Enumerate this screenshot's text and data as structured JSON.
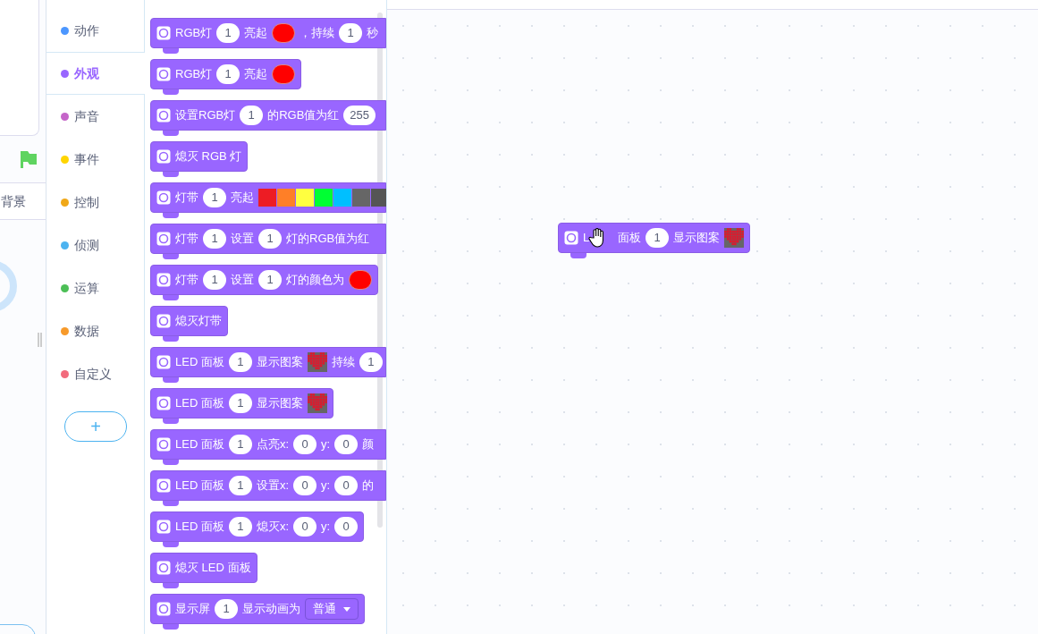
{
  "stage_tabs": [
    {
      "label": "背景",
      "selected": false
    }
  ],
  "categories": [
    {
      "label": "动作",
      "color": "#4c97ff",
      "selected": false
    },
    {
      "label": "外观",
      "color": "#9966ff",
      "selected": true
    },
    {
      "label": "声音",
      "color": "#c565c9",
      "selected": false
    },
    {
      "label": "事件",
      "color": "#ffd500",
      "selected": false
    },
    {
      "label": "控制",
      "color": "#f0a818",
      "selected": false
    },
    {
      "label": "侦测",
      "color": "#4cb3f0",
      "selected": false
    },
    {
      "label": "运算",
      "color": "#4cbf56",
      "selected": false
    },
    {
      "label": "数据",
      "color": "#f79a2a",
      "selected": false
    },
    {
      "label": "自定义",
      "color": "#f26b7c",
      "selected": false
    }
  ],
  "add_extension": {
    "label": "+"
  },
  "palette_blocks": [
    {
      "cut": true,
      "parts": [
        {
          "kind": "text",
          "text": "RGB灯"
        },
        {
          "kind": "number",
          "text": "1"
        },
        {
          "kind": "text",
          "text": "亮起"
        },
        {
          "kind": "color",
          "color": "#ff0000"
        },
        {
          "kind": "text",
          "text": "，持续"
        },
        {
          "kind": "number",
          "text": "1"
        },
        {
          "kind": "text",
          "text": "秒"
        }
      ]
    },
    {
      "cut": false,
      "parts": [
        {
          "kind": "text",
          "text": "RGB灯"
        },
        {
          "kind": "number",
          "text": "1"
        },
        {
          "kind": "text",
          "text": "亮起"
        },
        {
          "kind": "color",
          "color": "#ff0000"
        }
      ]
    },
    {
      "cut": true,
      "parts": [
        {
          "kind": "text",
          "text": "设置RGB灯"
        },
        {
          "kind": "number",
          "text": "1"
        },
        {
          "kind": "text",
          "text": "的RGB值为红"
        },
        {
          "kind": "number",
          "text": "255"
        }
      ]
    },
    {
      "cut": false,
      "parts": [
        {
          "kind": "text",
          "text": "熄灭 RGB 灯"
        }
      ]
    },
    {
      "cut": true,
      "parts": [
        {
          "kind": "text",
          "text": "灯带"
        },
        {
          "kind": "number",
          "text": "1"
        },
        {
          "kind": "text",
          "text": "亮起"
        },
        {
          "kind": "strip"
        }
      ]
    },
    {
      "cut": true,
      "parts": [
        {
          "kind": "text",
          "text": "灯带"
        },
        {
          "kind": "number",
          "text": "1"
        },
        {
          "kind": "text",
          "text": "设置"
        },
        {
          "kind": "number",
          "text": "1"
        },
        {
          "kind": "text",
          "text": "灯的RGB值为红"
        }
      ]
    },
    {
      "cut": false,
      "parts": [
        {
          "kind": "text",
          "text": "灯带"
        },
        {
          "kind": "number",
          "text": "1"
        },
        {
          "kind": "text",
          "text": "设置"
        },
        {
          "kind": "number",
          "text": "1"
        },
        {
          "kind": "text",
          "text": "灯的颜色为"
        },
        {
          "kind": "color",
          "color": "#ff0000"
        }
      ]
    },
    {
      "cut": false,
      "parts": [
        {
          "kind": "text",
          "text": "熄灭灯带"
        }
      ]
    },
    {
      "cut": true,
      "parts": [
        {
          "kind": "text",
          "text": "LED 面板"
        },
        {
          "kind": "number",
          "text": "1"
        },
        {
          "kind": "text",
          "text": "显示图案"
        },
        {
          "kind": "pattern"
        },
        {
          "kind": "text",
          "text": "持续"
        },
        {
          "kind": "number",
          "text": "1"
        }
      ]
    },
    {
      "cut": false,
      "parts": [
        {
          "kind": "text",
          "text": "LED 面板"
        },
        {
          "kind": "number",
          "text": "1"
        },
        {
          "kind": "text",
          "text": "显示图案"
        },
        {
          "kind": "pattern"
        }
      ]
    },
    {
      "cut": true,
      "parts": [
        {
          "kind": "text",
          "text": "LED 面板"
        },
        {
          "kind": "number",
          "text": "1"
        },
        {
          "kind": "text",
          "text": "点亮x:"
        },
        {
          "kind": "number",
          "text": "0"
        },
        {
          "kind": "text",
          "text": "y:"
        },
        {
          "kind": "number",
          "text": "0"
        },
        {
          "kind": "text",
          "text": "颜"
        }
      ]
    },
    {
      "cut": true,
      "parts": [
        {
          "kind": "text",
          "text": "LED 面板"
        },
        {
          "kind": "number",
          "text": "1"
        },
        {
          "kind": "text",
          "text": "设置x:"
        },
        {
          "kind": "number",
          "text": "0"
        },
        {
          "kind": "text",
          "text": "y:"
        },
        {
          "kind": "number",
          "text": "0"
        },
        {
          "kind": "text",
          "text": "的"
        }
      ]
    },
    {
      "cut": false,
      "parts": [
        {
          "kind": "text",
          "text": "LED 面板"
        },
        {
          "kind": "number",
          "text": "1"
        },
        {
          "kind": "text",
          "text": "熄灭x:"
        },
        {
          "kind": "number",
          "text": "0"
        },
        {
          "kind": "text",
          "text": "y:"
        },
        {
          "kind": "number",
          "text": "0"
        }
      ]
    },
    {
      "cut": false,
      "parts": [
        {
          "kind": "text",
          "text": "熄灭 LED 面板"
        }
      ]
    },
    {
      "cut": false,
      "parts": [
        {
          "kind": "text",
          "text": "显示屏"
        },
        {
          "kind": "number",
          "text": "1"
        },
        {
          "kind": "text",
          "text": "显示动画为"
        },
        {
          "kind": "dropdown",
          "text": "普通"
        }
      ]
    }
  ],
  "workspace_block": {
    "parts": [
      {
        "kind": "text",
        "text": "L"
      },
      {
        "kind": "cursor"
      },
      {
        "kind": "text",
        "text": "面板"
      },
      {
        "kind": "number",
        "text": "1"
      },
      {
        "kind": "text",
        "text": "显示图案"
      },
      {
        "kind": "pattern"
      }
    ]
  }
}
